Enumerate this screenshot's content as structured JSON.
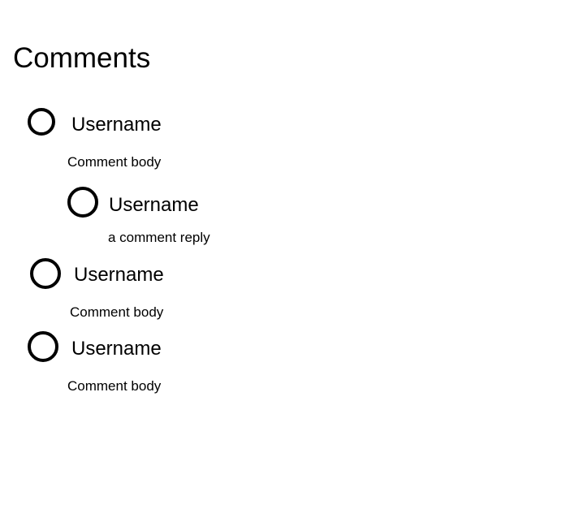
{
  "page": {
    "title": "Comments"
  },
  "comments": [
    {
      "username": "Username",
      "body": "Comment body",
      "replies": [
        {
          "username": "Username",
          "body": "a comment reply"
        }
      ]
    },
    {
      "username": "Username",
      "body": "Comment body",
      "replies": []
    },
    {
      "username": "Username",
      "body": "Comment body",
      "replies": []
    }
  ],
  "icons": {
    "avatar": "avatar-circle-icon"
  },
  "colors": {
    "text": "#000000",
    "background": "#ffffff",
    "avatar_stroke": "#000000"
  }
}
